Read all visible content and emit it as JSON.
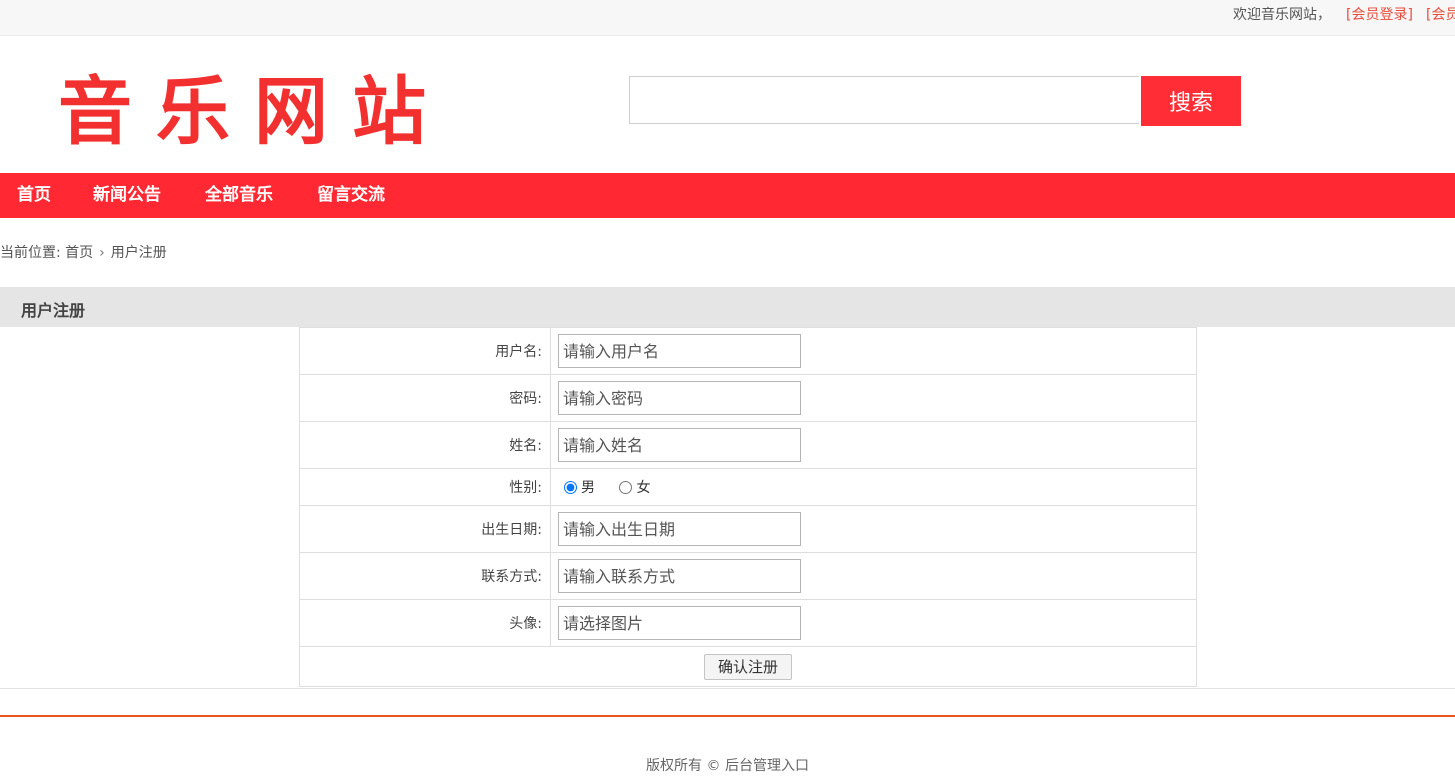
{
  "topbar": {
    "welcome": "欢迎音乐网站，",
    "login_link": "[会员登录]",
    "register_link": "[会员"
  },
  "header": {
    "logo_text": "音乐网站",
    "search_placeholder": "",
    "search_button": "搜索"
  },
  "nav": {
    "items": [
      "首页",
      "新闻公告",
      "全部音乐",
      "留言交流"
    ]
  },
  "breadcrumb": {
    "prefix": "当前位置:",
    "home": "首页",
    "separator": "›",
    "current": "用户注册"
  },
  "section": {
    "title": "用户注册"
  },
  "form": {
    "username_label": "用户名:",
    "username_placeholder": "请输入用户名",
    "password_label": "密码:",
    "password_placeholder": "请输入密码",
    "name_label": "姓名:",
    "name_placeholder": "请输入姓名",
    "gender_label": "性别:",
    "gender_options": [
      "男",
      "女"
    ],
    "gender_selected": "男",
    "birthdate_label": "出生日期:",
    "birthdate_placeholder": "请输入出生日期",
    "contact_label": "联系方式:",
    "contact_placeholder": "请输入联系方式",
    "avatar_label": "头像:",
    "avatar_placeholder": "请选择图片",
    "submit_button": "确认注册"
  },
  "footer": {
    "text": "版权所有 © 后台管理入口"
  },
  "colors": {
    "brand_red": "#ff2833",
    "logo_red": "#f23030",
    "link_red": "#e84c3d",
    "footer_line": "#e8541c"
  }
}
